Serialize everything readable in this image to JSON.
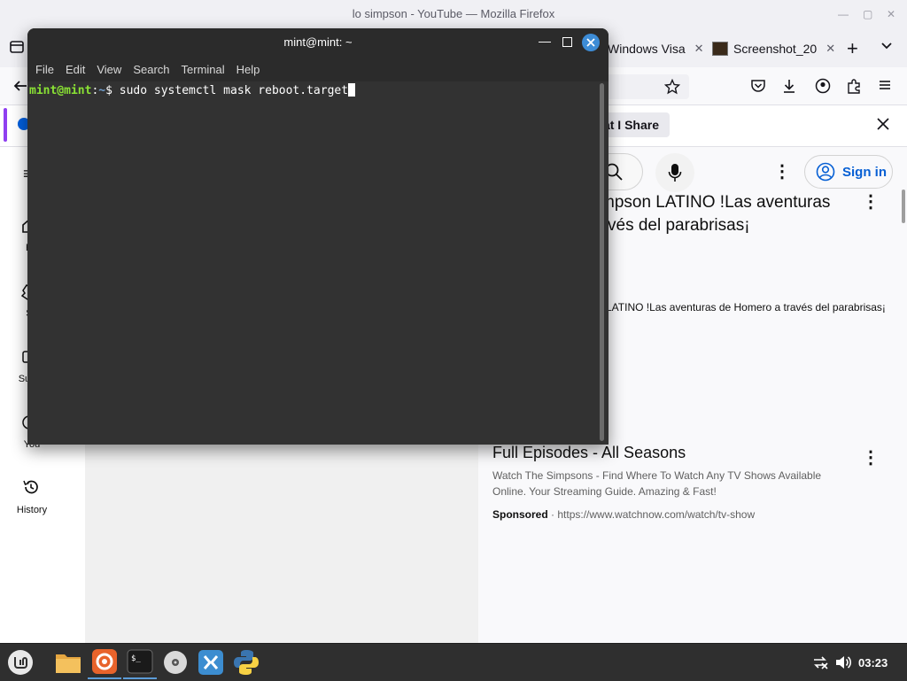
{
  "firefox": {
    "window_title": "lo simpson - YouTube — Mozilla Firefox",
    "tabs": [
      {
        "label": "Windows Visa"
      },
      {
        "label": "Screenshot_20"
      }
    ],
    "notification": {
      "button_label": "at I Share"
    }
  },
  "youtube": {
    "sign_in_label": "Sign in",
    "nav": [
      {
        "label": "Ho"
      },
      {
        "label": "Sh"
      },
      {
        "label": "Subsc"
      },
      {
        "label": "You"
      },
      {
        "label": "History"
      }
    ],
    "video": {
      "title_line1": "mpson LATINO !Las aventuras",
      "title_line2": "vés del parabrisas¡",
      "description": "LATINO !Las aventuras de Homero a través del parabrisas¡"
    },
    "ad": {
      "title": "Full Episodes - All Seasons",
      "desc_line1": "Watch The Simpsons - Find Where To Watch Any TV Shows Available",
      "desc_line2": "Online. Your Streaming Guide. Amazing & Fast!",
      "sponsored": "Sponsored",
      "separator": "·",
      "url": "https://www.watchnow.com/watch/tv-show"
    }
  },
  "terminal": {
    "title": "mint@mint: ~",
    "menu": [
      "File",
      "Edit",
      "View",
      "Search",
      "Terminal",
      "Help"
    ],
    "prompt_user": "mint@mint",
    "prompt_sep": ":",
    "prompt_path": "~",
    "prompt_symbol": "$ ",
    "command": "sudo systemctl mask reboot.target"
  },
  "taskbar": {
    "clock": "03:23",
    "apps": [
      {
        "name": "menu-icon"
      },
      {
        "name": "files-icon"
      },
      {
        "name": "firefox-icon"
      },
      {
        "name": "terminal-icon"
      },
      {
        "name": "disc-icon"
      },
      {
        "name": "app-icon"
      },
      {
        "name": "python-icon"
      }
    ]
  },
  "colors": {
    "terminal_bg": "#323232",
    "prompt_user": "#8ae234",
    "prompt_path": "#729fcf",
    "taskbar_bg": "#2f2f2f",
    "youtube_link": "#065fd4"
  }
}
